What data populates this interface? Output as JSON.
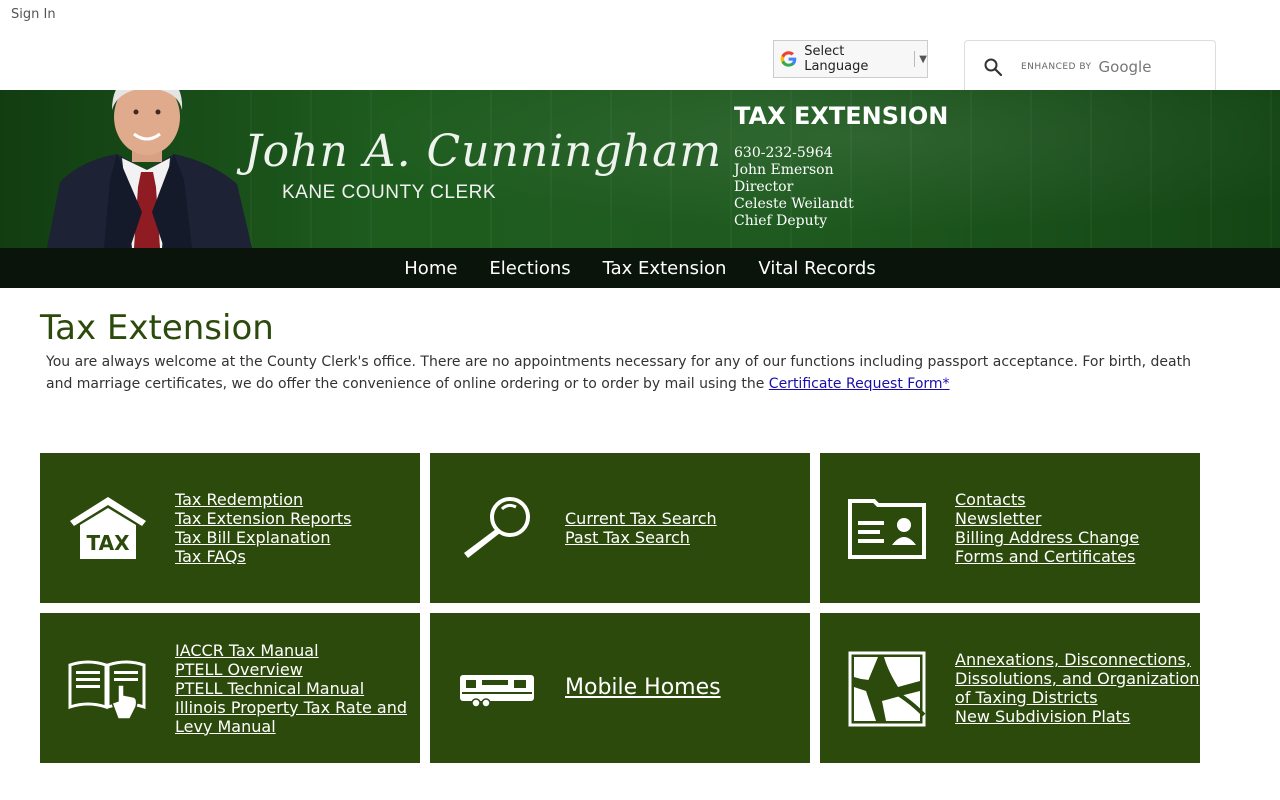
{
  "topbar": {
    "signin": "Sign In",
    "language": "Select Language",
    "search_enhanced": "ENHANCED BY",
    "search_google": "Google"
  },
  "banner": {
    "signature": "John A. Cunningham",
    "clerk_title": "KANE COUNTY CLERK",
    "dept_title": "TAX EXTENSION",
    "phone": "630-232-5964",
    "director_name": "John Emerson",
    "director_role": "Director",
    "deputy_name": "Celeste Weilandt",
    "deputy_role": "Chief Deputy"
  },
  "nav": {
    "items": [
      {
        "label": "Home"
      },
      {
        "label": "Elections"
      },
      {
        "label": "Tax Extension"
      },
      {
        "label": "Vital Records"
      }
    ]
  },
  "main": {
    "title": "Tax Extension",
    "intro_text": "You are always welcome at the County Clerk's office.  There are no appointments necessary for any of our functions including passport acceptance.  For birth, death and marriage certificates, we do offer the convenience of online ordering or to order by mail using the ",
    "intro_link": "Certificate Request Form*"
  },
  "tiles": [
    {
      "icon": "tax-house-icon",
      "links": [
        "Tax Redemption",
        "Tax Extension Reports",
        "Tax Bill Explanation",
        "Tax FAQs"
      ]
    },
    {
      "icon": "magnifier-icon",
      "links": [
        "Current Tax Search",
        "Past Tax Search"
      ]
    },
    {
      "icon": "id-card-folder-icon",
      "links": [
        "Contacts",
        "Newsletter",
        "Billing Address Change",
        "Forms and Certificates"
      ]
    },
    {
      "icon": "manual-book-icon",
      "links": [
        "IACCR Tax Manual",
        "PTELL Overview",
        "PTELL Technical Manual",
        "Illinois Property Tax Rate and",
        "Levy Manual"
      ]
    },
    {
      "icon": "mobile-home-icon",
      "links": [
        "Mobile Homes"
      ]
    },
    {
      "icon": "map-icon",
      "links": [
        "Annexations, Disconnections,",
        "Dissolutions, and Organization",
        "of Taxing Districts",
        "New Subdivision Plats"
      ]
    }
  ],
  "colors": {
    "banner_green": "#1f5b20",
    "tile_green": "#2b4a0b",
    "nav_dark": "#0b140b",
    "title_green": "#2b4a0b"
  }
}
